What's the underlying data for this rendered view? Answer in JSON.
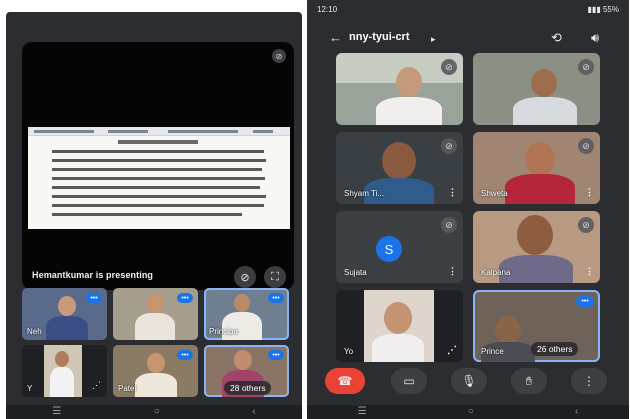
{
  "left_phone": {
    "presenter_label": "Hemantkumar is presenting",
    "tiles": [
      {
        "name": "Neh"
      },
      {
        "name": ""
      },
      {
        "name": "Principa"
      },
      {
        "name": "Y"
      },
      {
        "name": "Patel"
      },
      {
        "name": ""
      }
    ],
    "others_label": "28 others"
  },
  "right_phone": {
    "status": {
      "time": "12:10",
      "battery": "55%"
    },
    "meeting_code": "nny-tyui-crt",
    "tiles": [
      {
        "name": ""
      },
      {
        "name": ""
      },
      {
        "name": "Shyam Ti..."
      },
      {
        "name": "Shweta"
      },
      {
        "name": "Sujata",
        "initial": "S"
      },
      {
        "name": "Kalpana"
      },
      {
        "name": "Yo"
      },
      {
        "name": "Prince"
      }
    ],
    "others_label": "26 others"
  },
  "icons": {
    "mic_off": "mic-off-icon",
    "back": "back-arrow-icon",
    "camera_switch": "camera-switch-icon",
    "speaker": "speaker-icon",
    "end_call": "end-call-icon",
    "video": "video-icon",
    "mic": "mic-icon",
    "raise_hand": "raise-hand-icon",
    "more": "more-vertical-icon"
  },
  "colors": {
    "background": "#2b2d31",
    "accent_blue": "#1a73e8",
    "end_call_red": "#ea4335",
    "active_outline": "#8ab4f8"
  }
}
